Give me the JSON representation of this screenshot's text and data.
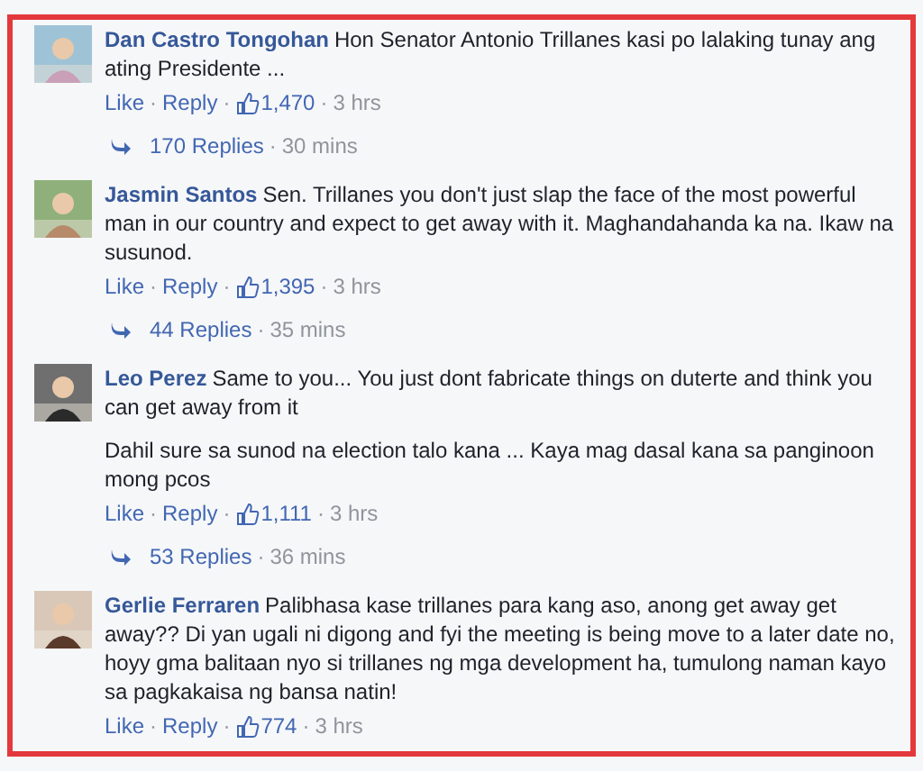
{
  "separator": "·",
  "comments": [
    {
      "author": "Dan Castro Tongohan",
      "paragraphs": [
        "Hon Senator Antonio Trillanes kasi po lalaking tunay ang ating Presidente ..."
      ],
      "like_label": "Like",
      "reply_label": "Reply",
      "likes": "1,470",
      "time": "3 hrs",
      "replies": {
        "count": "170 Replies",
        "time": "30 mins"
      }
    },
    {
      "author": "Jasmin Santos",
      "paragraphs": [
        "Sen. Trillanes you don't just slap the face of the most powerful man in our country and expect to get away with it. Maghandahanda ka na. Ikaw na susunod."
      ],
      "like_label": "Like",
      "reply_label": "Reply",
      "likes": "1,395",
      "time": "3 hrs",
      "replies": {
        "count": "44 Replies",
        "time": "35 mins"
      }
    },
    {
      "author": "Leo Perez",
      "paragraphs": [
        "Same to you... You just dont fabricate things on duterte and think you can get away from it",
        "Dahil sure sa sunod na election talo kana ... Kaya mag dasal kana sa panginoon mong pcos"
      ],
      "like_label": "Like",
      "reply_label": "Reply",
      "likes": "1,111",
      "time": "3 hrs",
      "replies": {
        "count": "53 Replies",
        "time": "36 mins"
      }
    },
    {
      "author": "Gerlie Ferraren",
      "paragraphs": [
        "Palibhasa kase trillanes para kang aso, anong get away get away?? Di yan ugali ni digong and fyi the meeting is being move to a later date no, hoyy gma balitaan nyo si trillanes ng mga development ha, tumulong naman kayo sa pagkakaisa ng bansa natin!"
      ],
      "like_label": "Like",
      "reply_label": "Reply",
      "likes": "774",
      "time": "3 hrs"
    }
  ]
}
